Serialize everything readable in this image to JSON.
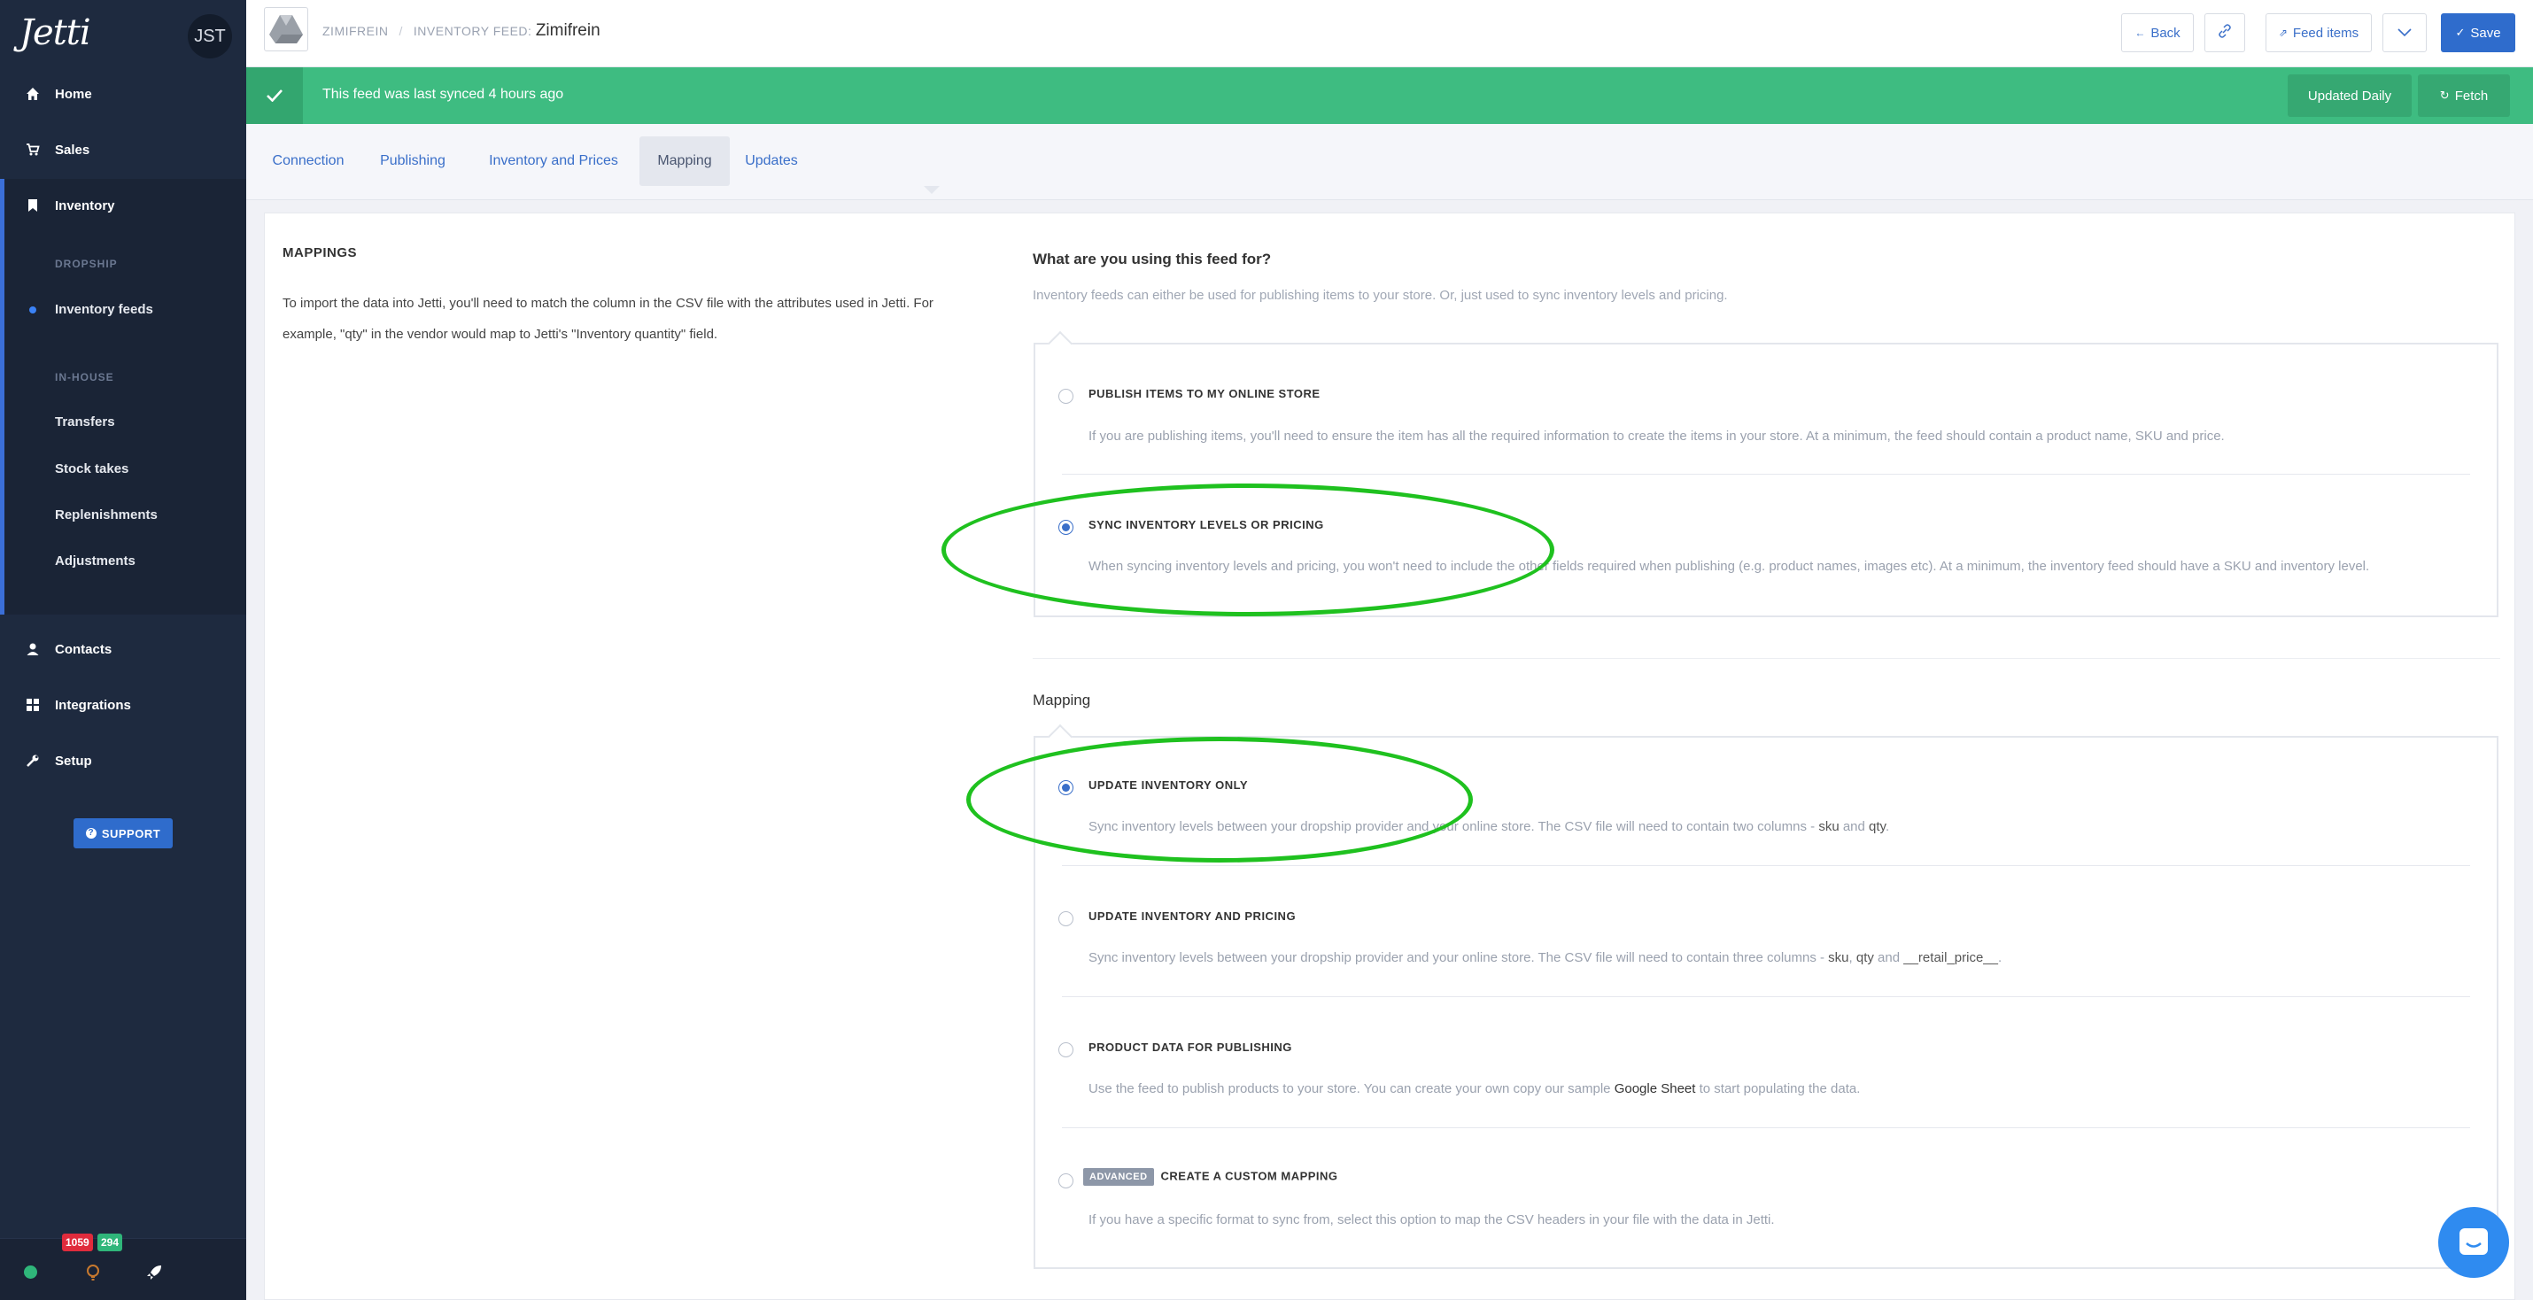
{
  "sidebar": {
    "logo": "Jetti",
    "avatar": "JST",
    "nav": {
      "home": "Home",
      "sales": "Sales",
      "inventory": "Inventory",
      "contacts": "Contacts",
      "integrations": "Integrations",
      "setup": "Setup"
    },
    "dropship_heading": "DROPSHIP",
    "inventory_feeds": "Inventory feeds",
    "inhouse_heading": "IN-HOUSE",
    "inhouse_items": [
      "Transfers",
      "Stock takes",
      "Replenishments",
      "Adjustments"
    ],
    "support": "SUPPORT",
    "badges": {
      "red": "1059",
      "green": "294",
      "red_color": "#e02b3c",
      "green_color": "#2fb67a"
    }
  },
  "topbar": {
    "crumb_root": "ZIMIFREIN",
    "crumb_sep": "/",
    "crumb_label": "INVENTORY FEED:",
    "crumb_current": "Zimifrein",
    "back": "Back",
    "feed_items": "Feed items",
    "save": "Save"
  },
  "sync": {
    "text": "This feed was last synced 4 hours ago",
    "schedule": "Updated Daily",
    "fetch": "Fetch"
  },
  "tabs": [
    "Connection",
    "Publishing",
    "Inventory and Prices",
    "Mapping",
    "Updates"
  ],
  "active_tab": "Mapping",
  "mappings": {
    "title": "MAPPINGS",
    "description": "To import the data into Jetti, you'll need to match the column in the CSV file with the attributes used in Jetti. For example, \"qty\" in the vendor would map to Jetti's \"Inventory quantity\" field."
  },
  "usage": {
    "question": "What are you using this feed for?",
    "subtitle": "Inventory feeds can either be used for publishing items to your store. Or, just used to sync inventory levels and pricing.",
    "options": [
      {
        "title": "PUBLISH ITEMS TO MY ONLINE STORE",
        "desc": "If you are publishing items, you'll need to ensure the item has all the required information to create the items in your store. At a minimum, the feed should contain a product name, SKU and price.",
        "selected": false
      },
      {
        "title": "SYNC INVENTORY LEVELS OR PRICING",
        "desc": "When syncing inventory levels and pricing, you won't need to include the other fields required when publishing (e.g. product names, images etc). At a minimum, the inventory feed should have a SKU and inventory level.",
        "selected": true
      }
    ]
  },
  "mapping": {
    "title": "Mapping",
    "options": [
      {
        "title": "UPDATE INVENTORY ONLY",
        "desc_pre": "Sync inventory levels between your dropship provider and your online store. The CSV file will need to contain two columns - ",
        "col1": "sku",
        "mid": " and ",
        "col2": "qty",
        "post": ".",
        "selected": true
      },
      {
        "title": "UPDATE INVENTORY AND PRICING",
        "desc_pre": "Sync inventory levels between your dropship provider and your online store. The CSV file will need to contain three columns - ",
        "col1": "sku",
        "sep1": ", ",
        "col2": "qty",
        "mid": " and ",
        "col3": "__retail_price__",
        "post": ".",
        "selected": false
      },
      {
        "title": "PRODUCT DATA FOR PUBLISHING",
        "desc_pre": "Use the feed to publish products to your store. You can create your own copy our sample ",
        "link": "Google Sheet",
        "post": " to start populating the data.",
        "selected": false
      },
      {
        "badge": "ADVANCED",
        "title": "CREATE A CUSTOM MAPPING",
        "desc": "If you have a specific format to sync from, select this option to map the CSV headers in your file with the data in Jetti.",
        "selected": false
      }
    ]
  },
  "colors": {
    "accent": "#2f6ccc",
    "sync_green": "#3ebc81",
    "sidebar": "#1e2a3f",
    "annotation": "#1fc11f"
  }
}
